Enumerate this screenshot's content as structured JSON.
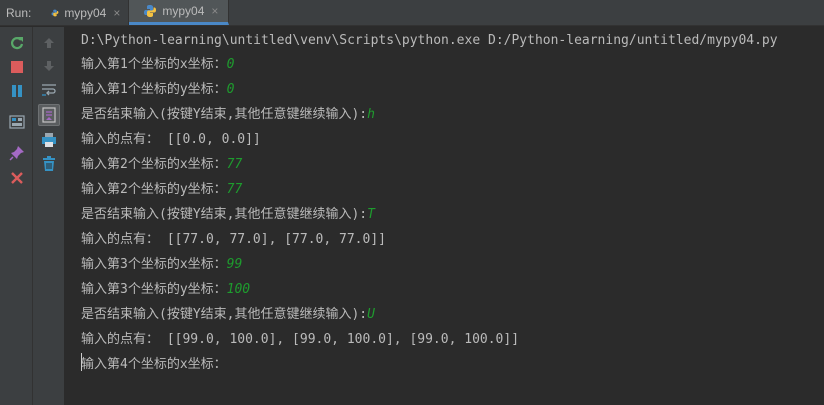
{
  "run_label": "Run:",
  "tabs": [
    {
      "label": "mypy04",
      "close": "×"
    },
    {
      "label": "mypy04",
      "close": "×"
    }
  ],
  "toolbar": {
    "rerun_icon": "rerun-icon",
    "stop_icon": "stop-icon",
    "pause_icon": "pause-icon",
    "layout_icon": "layout-icon",
    "pin_icon": "pin-icon",
    "close_icon": "close-icon",
    "up_icon": "arrow-up-icon",
    "down_icon": "arrow-down-icon",
    "soft_wrap_icon": "soft-wrap-icon",
    "scroll_end_icon": "scroll-to-end-icon",
    "print_icon": "print-icon",
    "trash_icon": "trash-icon"
  },
  "colors": {
    "input": "#1e9c2e",
    "output": "#bababa",
    "background": "#2b2b2b"
  },
  "console": {
    "lines": [
      {
        "text": "D:\\Python-learning\\untitled\\venv\\Scripts\\python.exe D:/Python-learning/untitled/mypy04.py",
        "input": ""
      },
      {
        "text": "输入第1个坐标的x坐标：",
        "input": "0"
      },
      {
        "text": "输入第1个坐标的y坐标：",
        "input": "0"
      },
      {
        "text": "是否结束输入(按键Y结束,其他任意键继续输入):",
        "input": "h"
      },
      {
        "text": "输入的点有： [[0.0, 0.0]]",
        "input": ""
      },
      {
        "text": "输入第2个坐标的x坐标：",
        "input": "77"
      },
      {
        "text": "输入第2个坐标的y坐标：",
        "input": "77"
      },
      {
        "text": "是否结束输入(按键Y结束,其他任意键继续输入):",
        "input": "T"
      },
      {
        "text": "输入的点有： [[77.0, 77.0], [77.0, 77.0]]",
        "input": ""
      },
      {
        "text": "输入第3个坐标的x坐标：",
        "input": "99"
      },
      {
        "text": "输入第3个坐标的y坐标：",
        "input": "100"
      },
      {
        "text": "是否结束输入(按键Y结束,其他任意键继续输入):",
        "input": "U"
      },
      {
        "text": "输入的点有： [[99.0, 100.0], [99.0, 100.0], [99.0, 100.0]]",
        "input": ""
      },
      {
        "text": "输入第4个坐标的x坐标：",
        "input": ""
      }
    ]
  }
}
